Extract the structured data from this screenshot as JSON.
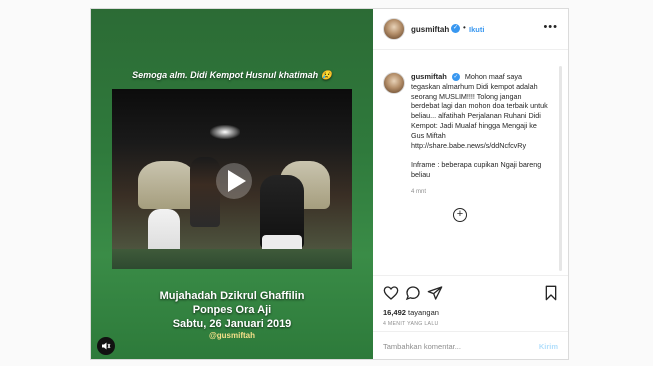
{
  "colors": {
    "accent": "#3897f0",
    "media_green": "#2f7a3c",
    "text": "#262626",
    "muted": "#8e8e8e"
  },
  "media": {
    "top_caption": "Semoga alm. Didi Kempot Husnul khatimah 😢",
    "lines": [
      "Mujahadah Dzikrul Ghaffilin",
      "Ponpes Ora Aji",
      "Sabtu, 26 Januari 2019"
    ],
    "handle": "@gusmiftah",
    "play_icon": "play-icon",
    "mute_icon": "speaker-icon"
  },
  "header": {
    "username": "gusmiftah",
    "verified_icon": "verified-badge-icon",
    "separator": "•",
    "follow_label": "Ikuti",
    "more_icon": "more-options-icon"
  },
  "caption": {
    "username": "gusmiftah",
    "text": "Mohon maaf saya tegaskan almarhum Didi kempot adalah seorang MUSLIM!!!! Tolong jangan berdebat lagi dan mohon doa terbaik untuk beliau... alfatihah Perjalanan Ruhani Didi Kempot: Jadi Mualaf hingga Mengaji ke Gus Miftah http://share.babe.news/s/ddNcfcvRy\n\nInframe : beberapa cupikan Ngaji bareng beliau",
    "time": "4 mnt"
  },
  "load_more_label": "+",
  "actions": {
    "like_icon": "heart-icon",
    "comment_icon": "comment-icon",
    "share_icon": "share-icon",
    "save_icon": "bookmark-icon"
  },
  "stats": {
    "views_count": "16,492",
    "views_label": "tayangan",
    "time_ago": "4 MENIT YANG LALU"
  },
  "comment_box": {
    "placeholder": "Tambahkan komentar...",
    "post_label": "Kirim"
  }
}
